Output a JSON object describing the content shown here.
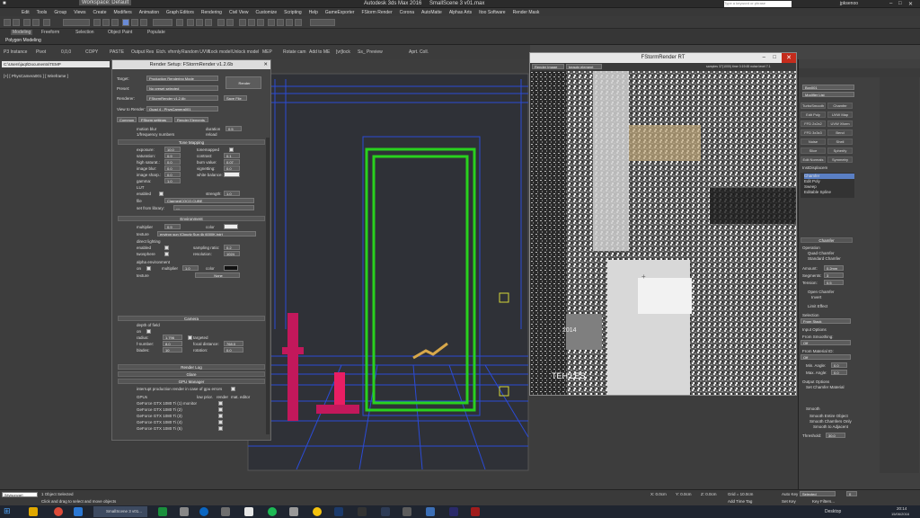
{
  "app": {
    "title": "Autodesk 3ds Max 2016",
    "file": "SmallScene 3 v01.max",
    "workspace": "Workspace: Default",
    "search_placeholder": "Type a keyword or phrase",
    "user": "jpksenoo"
  },
  "menu": [
    "Edit",
    "Tools",
    "Group",
    "Views",
    "Create",
    "Modifiers",
    "Animation",
    "Graph Editors",
    "Rendering",
    "Civil View",
    "Customize",
    "Scripting",
    "Help",
    "GameExporter",
    "FStorm Render",
    "Corona",
    "AutoMatte",
    "Alphas Arts",
    "Itoo Software",
    "Render Mask"
  ],
  "ribbon_tabs": [
    "Modeling",
    "Freeform",
    "Selection",
    "Object Paint",
    "Populate"
  ],
  "ribbon_sub": "Polygon Modeling",
  "ribbon_buttons": [
    "P3 Instance",
    "Pivot",
    "0,0,0",
    "COPY",
    "PASTE",
    "Output Res",
    "Etch. vfnrnly",
    "Random UVW",
    "Lock model",
    "Unlock model",
    "MEP",
    "Rotate cam",
    "Add to ME",
    "[vr]lock",
    "Ss_ Preview",
    "Aprt. Coll."
  ],
  "path_field": "C:\\Users\\jaqt\\Documents\\TEMP",
  "viewport_label": "[+] [ PhysCamera001 ] [ Wireframe ]",
  "render_setup": {
    "title": "Render Setup: FStormRender v1.2.6b",
    "target_label": "Target:",
    "target": "Production Rendering Mode",
    "preset_label": "Preset:",
    "preset": "No preset selected",
    "renderer_label": "Renderer:",
    "renderer": "FStormRender v1.2.6b",
    "save_file": "Save File",
    "view_label": "View to Render:",
    "view": "Quad 4 - PhysCamera001",
    "render_btn": "Render",
    "tabs": [
      "Common",
      "FStorm settings",
      "Render Elements"
    ],
    "motion_blur": "motion blur",
    "duration_label": "duration",
    "duration": "0.5",
    "interp": "1/frequency numbers",
    "reload": "reload",
    "tone_mapping": "Tone Mapping",
    "exposure_l": "exposure:",
    "exposure": "10.0",
    "saturation_l": "saturation:",
    "saturation": "0.9",
    "highsat_l": "high saturat.:",
    "highsat": "0.0",
    "imageblur_l": "image blur:",
    "imageblur": "0.0",
    "imagesharp_l": "image sharp.:",
    "imagesharp": "0.0",
    "gamma_l": "gamma:",
    "gamma": "1.0",
    "tonemapped_l": "tonemapped",
    "contrast_l": "contrast:",
    "contrast": "0.1",
    "burnvalue_l": "burn value:",
    "burnvalue": "0.07",
    "vignetting_l": "vignetting:",
    "vignetting": "0.0",
    "whitebal_l": "white balance:",
    "lut": "LUT",
    "lut_enabled": "enabled",
    "lut_strength_l": "strength:",
    "lut_strength": "1.0",
    "lut_file_l": "file",
    "lut_file": "ClarmedCOCO.CUBE",
    "lut_library_l": "set from library:",
    "lut_library": "---",
    "environment": "Environment",
    "multiplier_l": "multiplier",
    "multiplier": "0.9",
    "color_l": "color",
    "texture_l": "texture",
    "texture": "environ sun (Cloudy Sun 4k 6000K.hdr)",
    "direct_lighting": "direct lighting",
    "dl_enabled": "enabled",
    "sampling_l": "sampling ratio:",
    "sampling": "0.2",
    "twosphere": "twosphere",
    "resolution_l": "resolution:",
    "resolution": "1024",
    "alpha_env": "alpha environment",
    "alpha_on": "on",
    "alpha_mult_l": "multiplier",
    "alpha_mult": "1.0",
    "alpha_color_l": "color",
    "alpha_tex_l": "texture",
    "alpha_tex": "None",
    "camera": "Camera",
    "dof": "depth of field",
    "dof_on": "on",
    "radius_l": "radius:",
    "radius": "1.796",
    "fnumber_l": "f-number:",
    "fnumber": "8.0",
    "blades_l": "blades:",
    "blades": "10",
    "targeted": "targeted",
    "focal_l": "focal distance:",
    "focal": "768.0",
    "rotation_l": "rotation:",
    "rotation": "0.0",
    "render_log": "Render Log",
    "glare": "Glare",
    "gpu_manager": "GPU Manager",
    "interrupt": "interrupt production render in case of gpu errors",
    "gpu_cols": [
      "GPUs",
      "low prior.",
      "render",
      "mat. editor"
    ],
    "gpus": [
      "GeForce GTX 1080 Ti (1) monitor",
      "GeForce GTX 1080 Ti (2)",
      "GeForce GTX 1080 Ti (3)",
      "GeForce GTX 1080 Ti (4)",
      "GeForce GTX 1080 Ti (5)"
    ]
  },
  "fstorm_rt": {
    "title": "FStormRender RT",
    "channel": "Render Image",
    "element": "beauty element",
    "stats": "samples 37(1000) time 0:19:45 noise level 7.1",
    "watermark_a": "2014",
    "watermark_b": "TEH LES"
  },
  "right_panel": {
    "object_name": "Box001",
    "modifier_list": "Modifier List",
    "buttons": [
      "TurboSmooth",
      "Chamfer",
      "Edit Poly",
      "UVW Map",
      "FFD 2x2x2",
      "UVW Xform",
      "FFD 3x3x3",
      "Bend",
      "Noise",
      "Shell",
      "Slice",
      "Spherify",
      "Edit Normals",
      "Symmetry"
    ],
    "stack_title": "InstDisplacem",
    "stack": [
      "Chamfer",
      "Edit Poly",
      "Sweep",
      "Editable Spline"
    ],
    "chamfer_title": "Chamfer",
    "operation": "Operation",
    "quad_chamfer": "Quad Chamfer",
    "std_chamfer": "Standard Chamfer",
    "amount_l": "Amount:",
    "amount": "0.2mm",
    "segments_l": "Segments:",
    "segments": "3",
    "tension_l": "Tension:",
    "tension": "0.5",
    "open_chamfer": "Open Chamfer",
    "invert": "Invert",
    "limit_effect": "Limit Effect",
    "selection": "Selection",
    "sel_value": "From Stack",
    "input_options": "Input Options",
    "smoothing": "From Smoothing:",
    "smooth_value": "Off",
    "material": "From Material ID:",
    "mat_value": "Off",
    "min_angle_l": "Min. Angle:",
    "min_angle": "0.0",
    "max_angle_l": "Max. Angle:",
    "max_angle": "0.0",
    "output": "Output Options",
    "set_mat": "Set Chamfer Material",
    "smooth": "Smooth",
    "smooth_adj": "Smooth Entire Object",
    "smooth_ch": "Smooth Chamfers Only",
    "smooth_adj2": "Smooth to Adjacent",
    "threshold_l": "Threshold:",
    "threshold": "30.0"
  },
  "status": {
    "selected": "1 Object Selected",
    "hint": "Click and drag to select and move objects",
    "x": "X: 0.0cm",
    "y": "Y: 0.0cm",
    "z": "Z: 0.0cm",
    "grid": "Grid = 10.0cm",
    "autokey": "Auto Key",
    "setkey": "Set Key",
    "key_filters": "Key Filters...",
    "selected_dd": "Selected",
    "add_time_tag": "Add Time Tag",
    "script": "[Мyjsonvar]",
    "frame": "0"
  },
  "taskbar": {
    "active_app": "SmallScene 3 v01...",
    "desktop": "Desktop",
    "time": "20:14",
    "date": "15/06/2016"
  },
  "colors": {
    "green": "#29d11e",
    "blue": "#2b4bd6",
    "magenta": "#c2185b",
    "orange": "#d8a84a",
    "yellow": "#d6d63a"
  }
}
